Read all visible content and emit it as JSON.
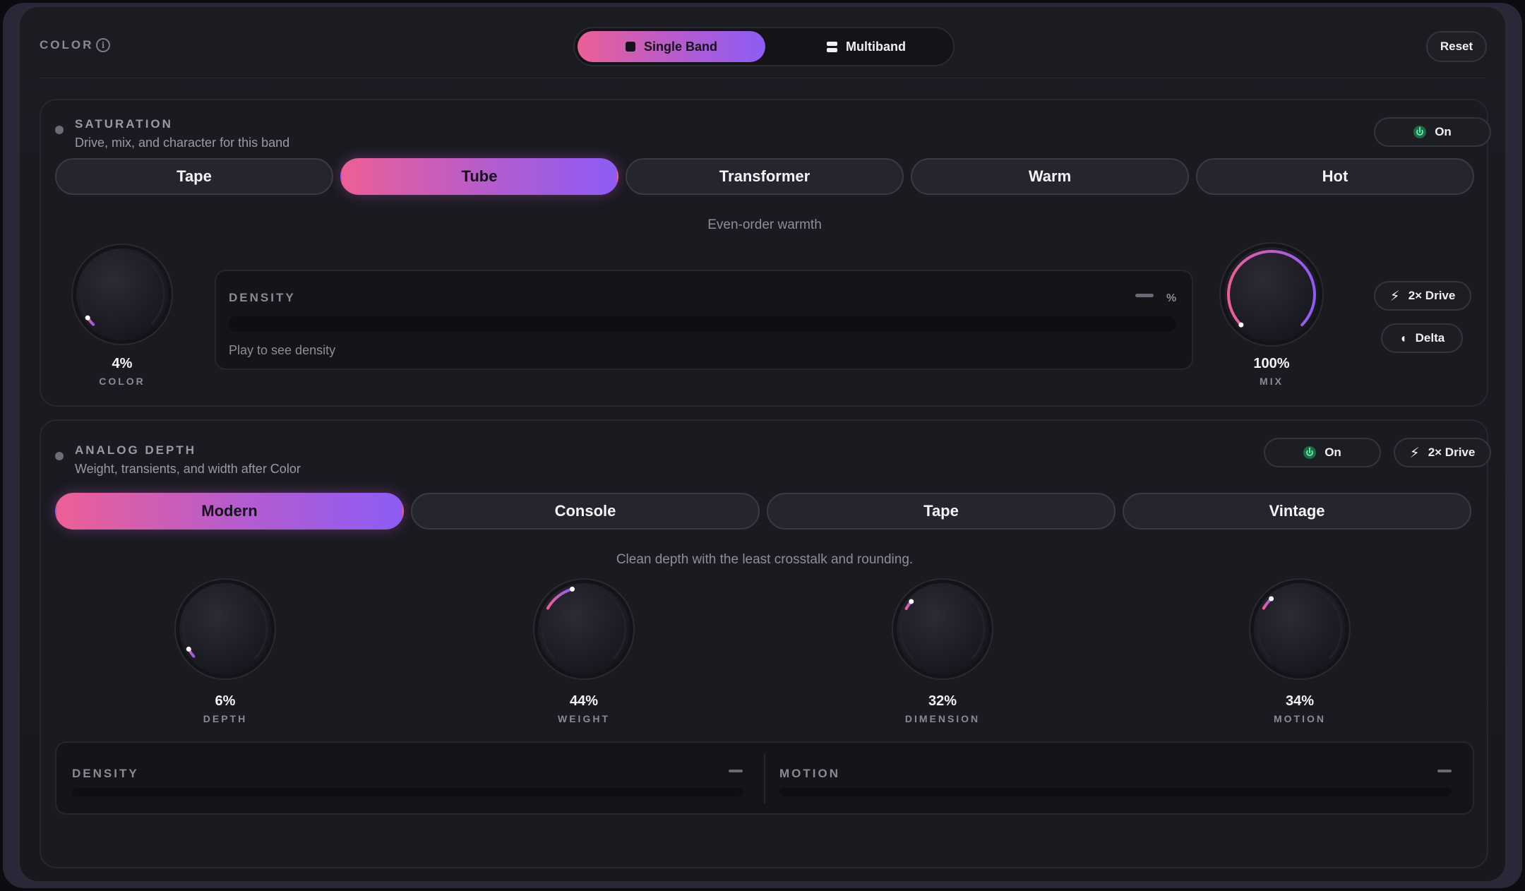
{
  "header": {
    "title": "COLOR",
    "modes": [
      "Single Band",
      "Multiband"
    ],
    "reset_label": "Reset"
  },
  "saturation": {
    "title": "SATURATION",
    "subtitle": "Drive, mix, and character for this band",
    "on_label": "On",
    "types": [
      "Tape",
      "Tube",
      "Transformer",
      "Warm",
      "Hot"
    ],
    "active_type": "Tube",
    "type_desc": "Even-order warmth",
    "color_knob": {
      "value": "4%",
      "label": "COLOR",
      "fraction": 0.04
    },
    "density": {
      "label": "DENSITY",
      "unit": "%",
      "hint": "Play to see density"
    },
    "mix_knob": {
      "value": "100%",
      "label": "MIX",
      "fraction": 1.0
    },
    "drive_label": "2× Drive",
    "delta_label": "Delta"
  },
  "analog": {
    "title": "ANALOG DEPTH",
    "subtitle": "Weight, transients, and width after Color",
    "on_label": "On",
    "drive_label": "2× Drive",
    "modes": [
      "Modern",
      "Console",
      "Tape",
      "Vintage"
    ],
    "active_mode": "Modern",
    "mode_desc": "Clean depth with the least crosstalk and rounding.",
    "knobs": [
      {
        "value": "6%",
        "label": "DEPTH",
        "fraction": 0.06
      },
      {
        "value": "44%",
        "label": "WEIGHT",
        "fraction": 0.44
      },
      {
        "value": "32%",
        "label": "DIMENSION",
        "fraction": 0.32
      },
      {
        "value": "34%",
        "label": "MOTION",
        "fraction": 0.34
      }
    ],
    "meters": [
      "DENSITY",
      "MOTION"
    ]
  },
  "colors": {
    "accent_start": "#ec5f96",
    "accent_end": "#8d5cf5",
    "on_green": "#6ce4a6"
  }
}
